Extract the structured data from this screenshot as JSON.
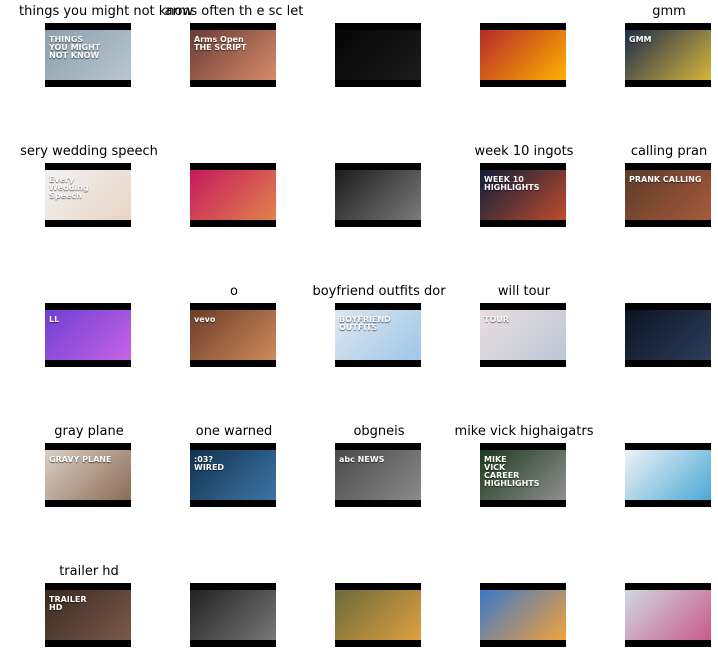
{
  "grid": {
    "rows": [
      {
        "cells": [
          {
            "title": "things you might not know",
            "thumb": {
              "overlay": "THINGS\nYOU MIGHT\nNOT KNOW",
              "colors": [
                "#8ea0ad",
                "#b7c6cf"
              ]
            }
          },
          {
            "title": "arms often th e sc let",
            "thumb": {
              "overlay": "Arms Open\nTHE SCRIPT",
              "colors": [
                "#6a3b34",
                "#d68c6c"
              ]
            }
          },
          {
            "title": "",
            "thumb": {
              "overlay": "",
              "colors": [
                "#050505",
                "#1c1c1c"
              ]
            }
          },
          {
            "title": "",
            "thumb": {
              "overlay": "",
              "colors": [
                "#b52a2a",
                "#ffb000"
              ]
            }
          },
          {
            "title": "gmm",
            "thumb": {
              "overlay": "GMM",
              "colors": [
                "#1d2d4d",
                "#d6b53a"
              ]
            }
          }
        ]
      },
      {
        "cells": [
          {
            "title": "sery wedding speech",
            "thumb": {
              "overlay": "Every\nWedding\nSpeech",
              "colors": [
                "#f2f2f2",
                "#e7d4c4"
              ]
            }
          },
          {
            "title": "",
            "thumb": {
              "overlay": "",
              "colors": [
                "#c51a5b",
                "#e1824c"
              ]
            }
          },
          {
            "title": "",
            "thumb": {
              "overlay": "",
              "colors": [
                "#1c1c1c",
                "#7a7a7a"
              ]
            }
          },
          {
            "title": "week 10 ingots",
            "thumb": {
              "overlay": "WEEK 10\nHIGHLIGHTS",
              "colors": [
                "#0c1f3b",
                "#c14b2c"
              ]
            }
          },
          {
            "title": "calling pran",
            "thumb": {
              "overlay": "PRANK CALLING",
              "colors": [
                "#5a3b2a",
                "#a85a3a"
              ]
            }
          }
        ]
      },
      {
        "cells": [
          {
            "title": "",
            "thumb": {
              "overlay": "LL",
              "colors": [
                "#6e3fd2",
                "#c763e6"
              ]
            }
          },
          {
            "title": "o",
            "thumb": {
              "overlay": "vevo",
              "colors": [
                "#6b3d2a",
                "#d08a5a"
              ]
            }
          },
          {
            "title": "boyfriend outfits dor",
            "thumb": {
              "overlay": "BOYFRIEND\nOUTFITS",
              "colors": [
                "#dde6ef",
                "#9ec7e8"
              ]
            }
          },
          {
            "title": "will tour",
            "thumb": {
              "overlay": "TOUR",
              "colors": [
                "#e9dde0",
                "#bcc7d5"
              ]
            }
          },
          {
            "title": "",
            "thumb": {
              "overlay": "",
              "colors": [
                "#0b1322",
                "#2c3e5c"
              ]
            }
          }
        ]
      },
      {
        "cells": [
          {
            "title": "gray plane",
            "thumb": {
              "overlay": "GRAVY PLANE",
              "colors": [
                "#d9cfc6",
                "#8c6c55"
              ]
            }
          },
          {
            "title": "one warned",
            "thumb": {
              "overlay": ":03?\nWIRED",
              "colors": [
                "#12324f",
                "#3c75a8"
              ]
            }
          },
          {
            "title": "obgneis",
            "thumb": {
              "overlay": "abc NEWS",
              "colors": [
                "#4a4a4a",
                "#8a8a8a"
              ]
            }
          },
          {
            "title": "mike vick highaigatrs",
            "thumb": {
              "overlay": "MIKE\nVICK\nCAREER\nHIGHLIGHTS",
              "colors": [
                "#1e3a1e",
                "#8f8f8f"
              ]
            }
          },
          {
            "title": "",
            "thumb": {
              "overlay": "",
              "colors": [
                "#eef2f5",
                "#4aa8d6"
              ]
            }
          }
        ]
      },
      {
        "cells": [
          {
            "title": "trailer hd",
            "thumb": {
              "overlay": "TRAILER\nHD",
              "colors": [
                "#3a2a22",
                "#7a5a4a"
              ]
            }
          },
          {
            "title": "",
            "thumb": {
              "overlay": "",
              "colors": [
                "#222222",
                "#777777"
              ]
            }
          },
          {
            "title": "",
            "thumb": {
              "overlay": "",
              "colors": [
                "#6a6a3a",
                "#e0a040"
              ]
            }
          },
          {
            "title": "",
            "thumb": {
              "overlay": "",
              "colors": [
                "#3a79c9",
                "#f2a23a"
              ]
            }
          },
          {
            "title": "",
            "thumb": {
              "overlay": "",
              "colors": [
                "#cfd8e0",
                "#c85a8a"
              ]
            }
          }
        ]
      }
    ]
  }
}
